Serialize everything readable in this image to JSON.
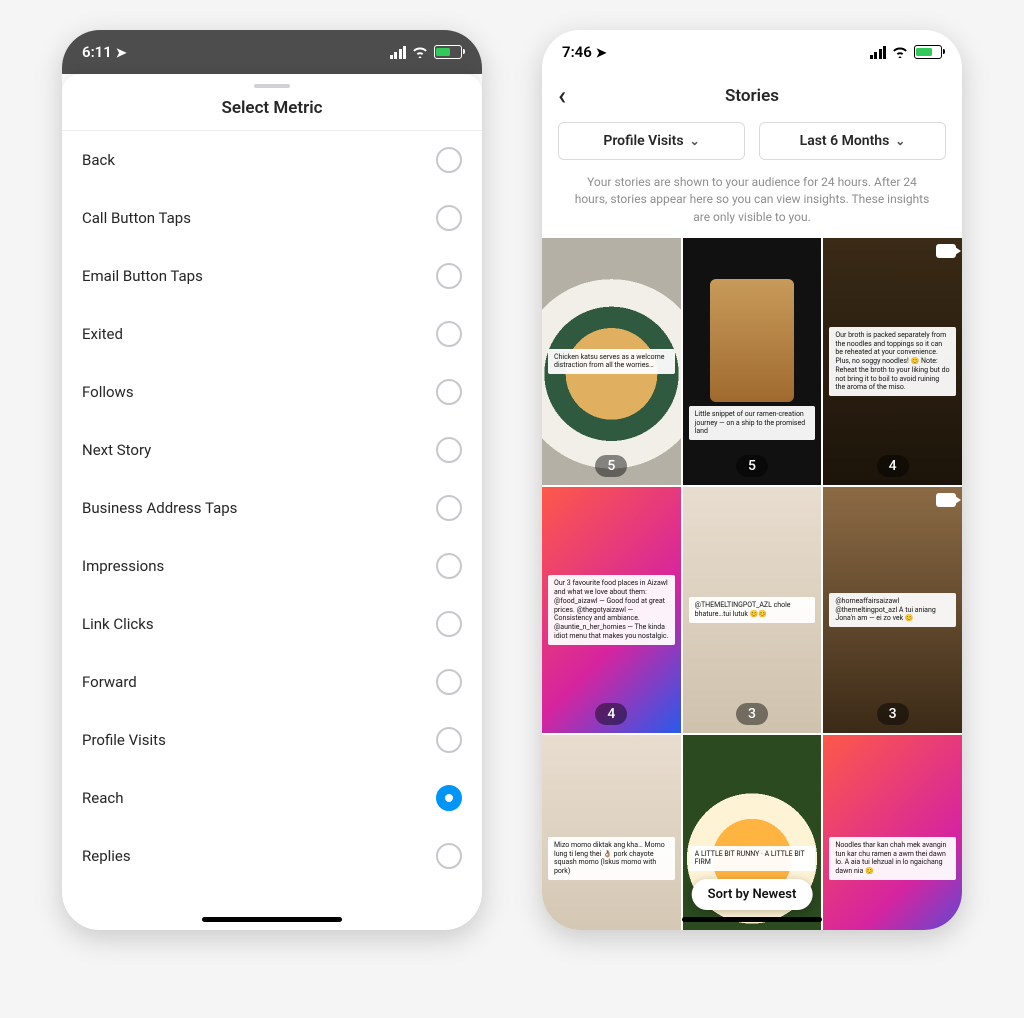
{
  "left": {
    "status": {
      "time": "6:11",
      "battery_pct": 55
    },
    "sheet_title": "Select Metric",
    "metrics": [
      {
        "label": "Back",
        "selected": false
      },
      {
        "label": "Call Button Taps",
        "selected": false
      },
      {
        "label": "Email Button Taps",
        "selected": false
      },
      {
        "label": "Exited",
        "selected": false
      },
      {
        "label": "Follows",
        "selected": false
      },
      {
        "label": "Next Story",
        "selected": false
      },
      {
        "label": "Business Address Taps",
        "selected": false
      },
      {
        "label": "Impressions",
        "selected": false
      },
      {
        "label": "Link Clicks",
        "selected": false
      },
      {
        "label": "Forward",
        "selected": false
      },
      {
        "label": "Profile Visits",
        "selected": false
      },
      {
        "label": "Reach",
        "selected": true
      },
      {
        "label": "Replies",
        "selected": false
      }
    ]
  },
  "right": {
    "status": {
      "time": "7:46",
      "battery_pct": 60
    },
    "header_title": "Stories",
    "filter_metric": "Profile Visits",
    "filter_range": "Last 6 Months",
    "helper_text": "Your stories are shown to your audience for 24 hours. After 24 hours, stories appear here so you can view insights. These insights are only visible to you.",
    "sort_label": "Sort by Newest",
    "tiles": [
      {
        "count": "5",
        "video": false,
        "style": "food1",
        "caption": "Chicken katsu serves as a welcome distraction from all the worries…"
      },
      {
        "count": "5",
        "video": false,
        "style": "dark",
        "caption": "Little snippet of our ramen-creation journey — on a ship to the promised land"
      },
      {
        "count": "4",
        "video": true,
        "style": "ramen",
        "caption": "Our broth is packed separately from the noodles and toppings so it can be reheated at your convenience. Plus, no soggy noodles! 😊  Note: Reheat the broth to your liking but do not bring it to boil to avoid ruining the aroma of the miso."
      },
      {
        "count": "4",
        "video": false,
        "style": "gradient",
        "caption": "Our 3 favourite food places in Aizawl and what we love about them: @food_aizawl — Good food at great prices. @thegotyaizawl — Consistency and ambiance. @auntie_n_her_homies — The kinda idiot menu that makes you nostalgic."
      },
      {
        "count": "3",
        "video": false,
        "style": "momo",
        "caption": "@THEMELTINGPOT_AZL  chole bhature…tui lutuk 😊😊"
      },
      {
        "count": "3",
        "video": true,
        "style": "curry",
        "caption": "@homeaffairsaizawl  @themeltingpot_azl A tui aniang Jona'n am — ei zo vek 😊"
      },
      {
        "count": "",
        "video": false,
        "style": "momo",
        "caption": "Mizo momo diktak ang kha… Momo lung ti leng thei 👌🏽  pork chayote squash momo (Iskus momo with pork)"
      },
      {
        "count": "",
        "video": false,
        "style": "egg",
        "caption": "A LITTLE BIT RUNNY · A LITTLE BIT FIRM"
      },
      {
        "count": "",
        "video": false,
        "style": "gradient",
        "caption": "Noodles thar kan chah mek avangin tun kar chu ramen a awm thei dawn lo. A aia tui lehzual in lo ngaichang dawn nia 😊"
      }
    ]
  }
}
